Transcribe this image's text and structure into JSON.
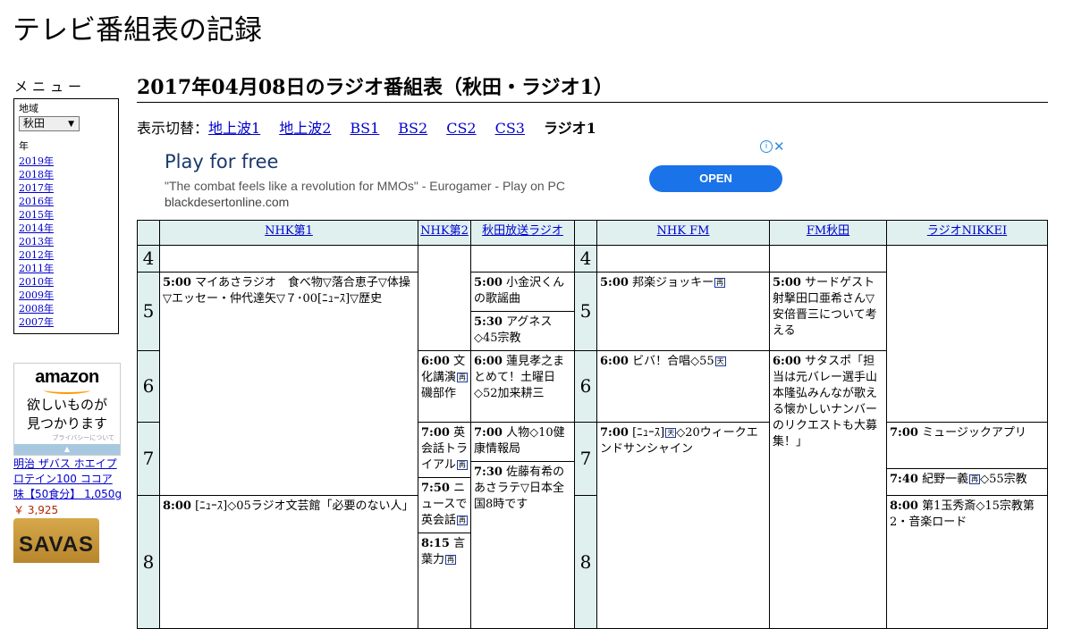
{
  "site": {
    "title": "テレビ番組表の記録"
  },
  "menu": {
    "label": "メニュー",
    "region_label": "地域",
    "region_value": "秋田",
    "year_label": "年",
    "years": [
      "2019年",
      "2018年",
      "2017年",
      "2016年",
      "2015年",
      "2014年",
      "2013年",
      "2012年",
      "2011年",
      "2010年",
      "2009年",
      "2008年",
      "2007年"
    ]
  },
  "amazon": {
    "logo": "amazon",
    "tagline_1": "欲しいものが",
    "tagline_2": "見つかります",
    "privacy": "プライバシーについて",
    "product_name": "明治 ザバス ホエイプロテイン100 ココア味【50食分】 1,050g",
    "product_price": "￥ 3,925",
    "product_brand": "SAVAS"
  },
  "page": {
    "heading": "2017年04月08日のラジオ番組表（秋田・ラジオ1）",
    "switch_label": "表示切替：",
    "links": [
      "地上波1",
      "地上波2",
      "BS1",
      "BS2",
      "CS2",
      "CS3"
    ],
    "current": "ラジオ1"
  },
  "ad": {
    "title": "Play for free",
    "description": "\"The combat feels like a revolution for MMOs\" - Eurogamer - Play on PC",
    "url": "blackdesertonline.com",
    "cta": "OPEN",
    "info": "ⓘ",
    "close": "✕"
  },
  "schedule": {
    "channels": [
      "NHK第1",
      "NHK第2",
      "秋田放送ラジオ",
      "NHK FM",
      "FM秋田",
      "ラジオNIKKEI"
    ],
    "hours": [
      "4",
      "5",
      "6",
      "7",
      "8"
    ],
    "hours_right": [
      "4",
      "5",
      "6",
      "7",
      "8"
    ],
    "programs": {
      "nhk1_500_time": "5:00",
      "nhk1_500_text": "マイあさラジオ　食べ物▽落合恵子▽体操▽エッセー・仲代達矢▽７･00[ﾆｭｰｽ]▽歴史",
      "nhk1_800_time": "8:00",
      "nhk1_800_text": "[ﾆｭｰｽ]◇05ラジオ文芸館「必要のない人」",
      "nhk2_600_time": "6:00",
      "nhk2_600_text_a": "文化講演",
      "nhk2_600_text_b": "　磯部作",
      "nhk2_700_time": "7:00",
      "nhk2_700_text": "英会話トライアル",
      "nhk2_750_time": "7:50",
      "nhk2_750_text": "ニュースで英会話",
      "nhk2_815_time": "8:15",
      "nhk2_815_text": "言葉力",
      "abs_500_time": "5:00",
      "abs_500_text": "小金沢くんの歌謡曲",
      "abs_530_time": "5:30",
      "abs_530_text": "アグネス◇45宗教",
      "abs_600_time": "6:00",
      "abs_600_text": "蓮見孝之まとめて！土曜日◇52加来耕三",
      "abs_700_time": "7:00",
      "abs_700_text": "人物◇10健康情報局",
      "abs_730_time": "7:30",
      "abs_730_text": "佐藤有希のあさラテ▽日本全国8時です",
      "fm_500_time": "5:00",
      "fm_500_text": "邦楽ジョッキー",
      "fm_600_time": "6:00",
      "fm_600_text": "ビバ！合唱◇55",
      "fm_700_time": "7:00",
      "fm_700_text_a": "[ﾆｭｰｽ]",
      "fm_700_text_b": "◇20ウィークエンドサンシャイン",
      "fma_500_time": "5:00",
      "fma_500_text": "サードゲスト射撃田口亜希さん▽安倍晋三について考える",
      "fma_600_time": "6:00",
      "fma_600_text": "サタスポ「担当は元バレー選手山本隆弘みんなが歌える懐かしいナンバーのリクエストも大募集！」",
      "nikkei_700_time": "7:00",
      "nikkei_700_text": "ミュージックアプリ",
      "nikkei_740_time": "7:40",
      "nikkei_740_text_a": "紀野一義",
      "nikkei_740_text_b": "◇55宗教",
      "nikkei_800_time": "8:00",
      "nikkei_800_text": "第1玉秀斎◇15宗教第2・音楽ロード"
    },
    "symbols": {
      "re": "再",
      "ten": "天"
    }
  }
}
